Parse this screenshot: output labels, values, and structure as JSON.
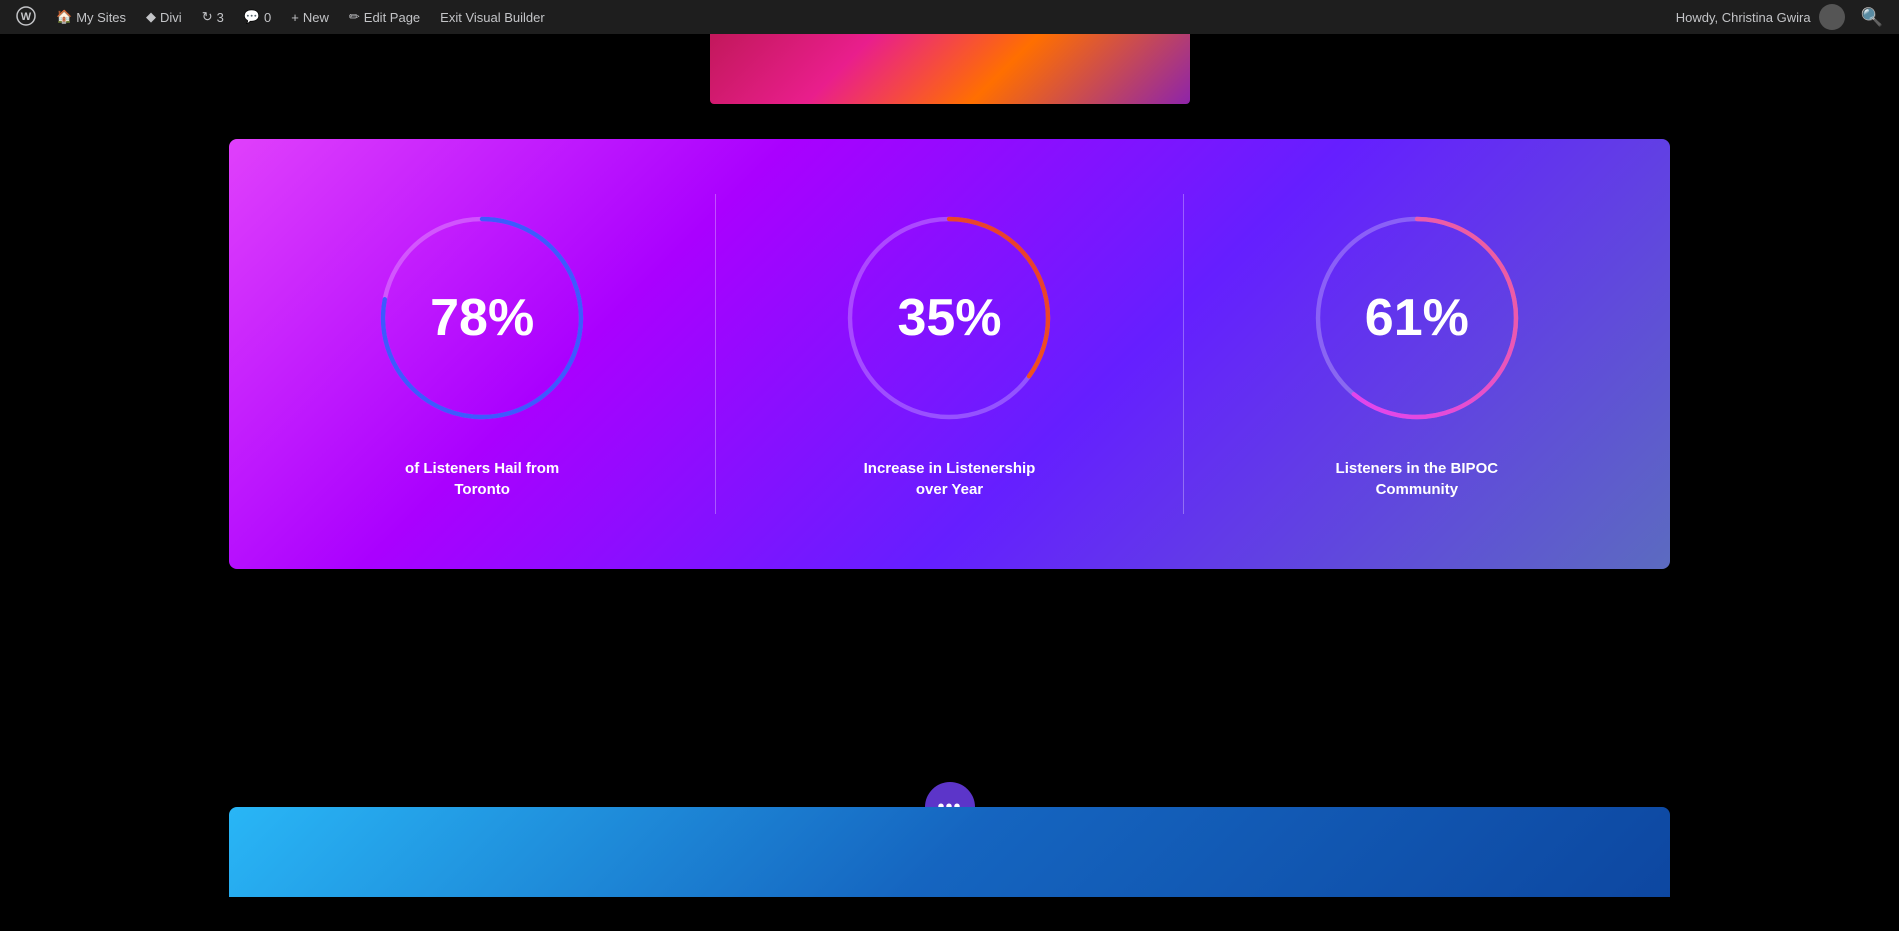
{
  "adminBar": {
    "wordpressIcon": "⊞",
    "mySites": "My Sites",
    "divi": "Divi",
    "updates": "3",
    "comments": "0",
    "new": "New",
    "editPage": "Edit Page",
    "exitBuilder": "Exit Visual Builder",
    "greeting": "Howdy, Christina Gwira",
    "searchIcon": "🔍"
  },
  "stats": [
    {
      "value": "78%",
      "percentage": 78,
      "label": "of Listeners Hail from Toronto",
      "progressColor": "#3d5afe",
      "id": "stat1"
    },
    {
      "value": "35%",
      "percentage": 35,
      "label": "Increase in Listenership over Year",
      "progressColor": "orange-red-gradient",
      "id": "stat2"
    },
    {
      "value": "61%",
      "percentage": 61,
      "label": "Listeners in the BIPOC Community",
      "progressColor": "pink-purple-gradient",
      "id": "stat3"
    }
  ],
  "dotsButton": "•••"
}
